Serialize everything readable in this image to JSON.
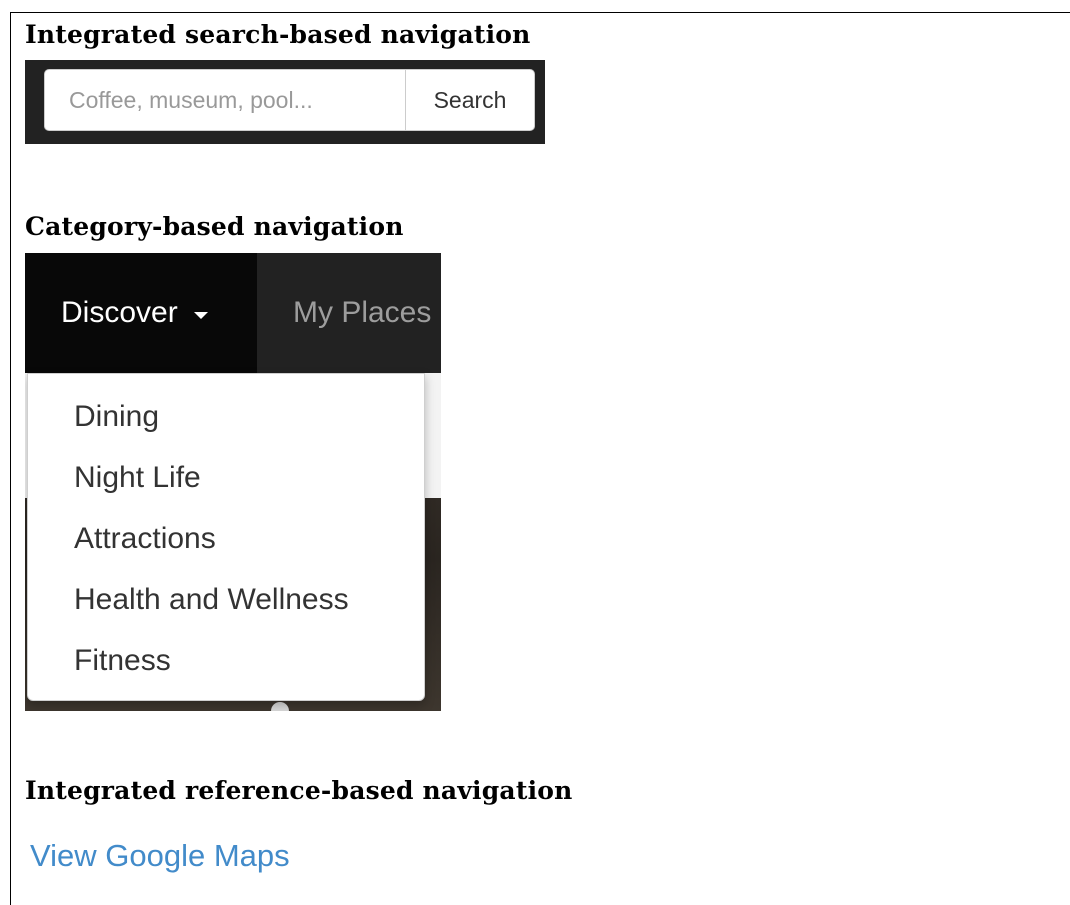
{
  "search_section": {
    "heading": "Integrated search-based navigation",
    "input_placeholder": "Coffee, museum, pool...",
    "button_label": "Search"
  },
  "category_section": {
    "heading": "Category-based navigation",
    "nav": {
      "discover_label": "Discover",
      "myplaces_label": "My Places"
    },
    "dropdown_items": [
      "Dining",
      "Night Life",
      "Attractions",
      "Health and Wellness",
      "Fitness"
    ]
  },
  "reference_section": {
    "heading": "Integrated reference-based navigation",
    "link_label": "View Google Maps"
  },
  "colors": {
    "navbar_bg": "#222222",
    "active_nav_bg": "#080808",
    "link_color": "#428bca"
  }
}
